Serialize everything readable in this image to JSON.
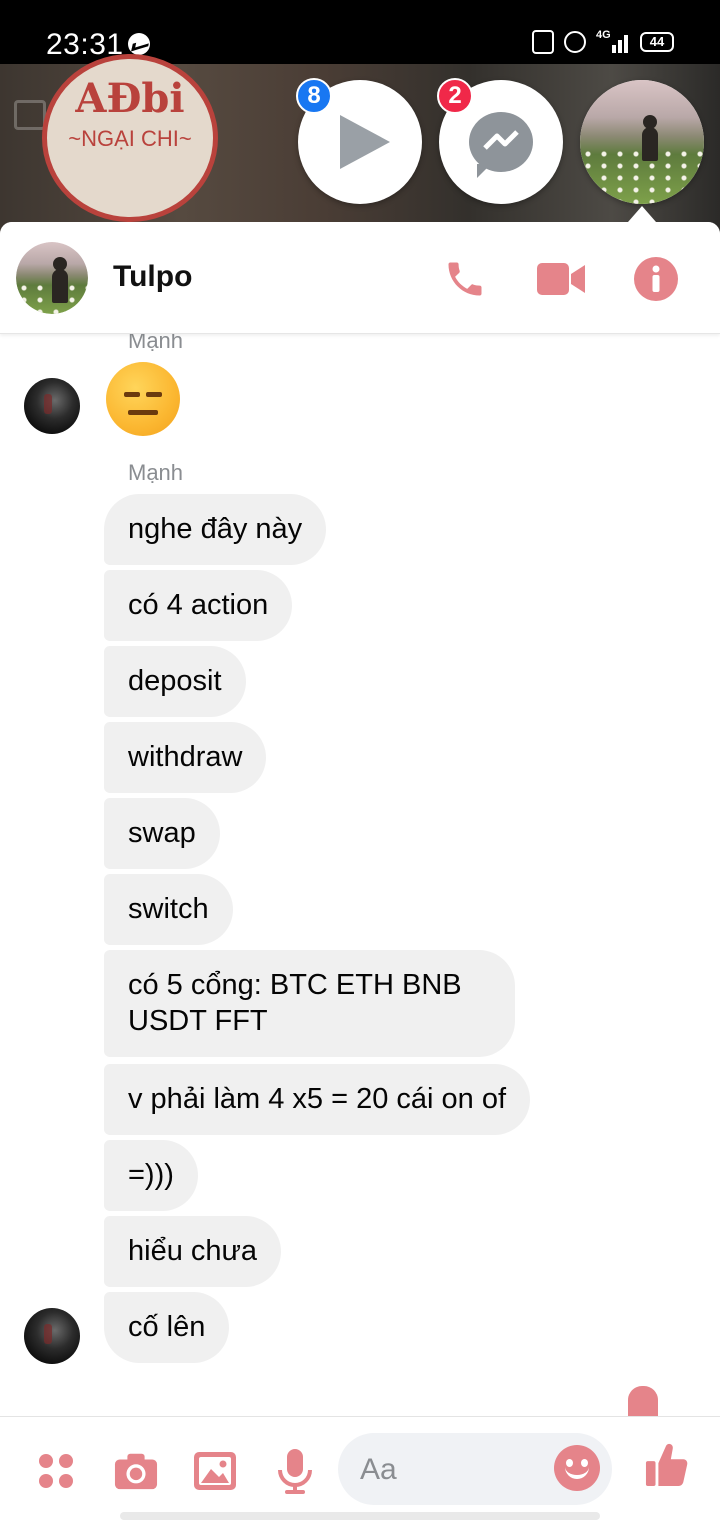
{
  "status_bar": {
    "time": "23:31",
    "battery": "44",
    "network": "4G"
  },
  "background": {
    "logo_line1": "AĐbi",
    "logo_line2": "~NGẠI CHI~"
  },
  "chat_heads": [
    {
      "name": "video-player",
      "badge": "8",
      "badge_color": "#1877f2"
    },
    {
      "name": "messenger",
      "badge": "2",
      "badge_color": "#f02849"
    },
    {
      "name": "tulpo-avatar"
    }
  ],
  "header": {
    "contact_name": "Tulpo",
    "accent_color": "#e5848a",
    "icons": [
      "phone-icon",
      "video-call-icon",
      "info-icon"
    ]
  },
  "conversation": {
    "partial_sender": "Mạnh",
    "emoji": "😑",
    "sender": "Mạnh",
    "messages": [
      "nghe đây này",
      "có 4 action",
      "deposit",
      "withdraw",
      "swap",
      "switch",
      "có 5 cổng:  BTC ETH BNB",
      "USDT FFT",
      "v phải làm 4 x5 = 20 cái on of",
      "=)))",
      "hiểu chưa",
      "cố lên"
    ]
  },
  "composer": {
    "placeholder": "Aa",
    "icons": [
      "apps-icon",
      "camera-icon",
      "gallery-icon",
      "microphone-icon",
      "emoji-icon",
      "thumbs-up-icon"
    ]
  }
}
